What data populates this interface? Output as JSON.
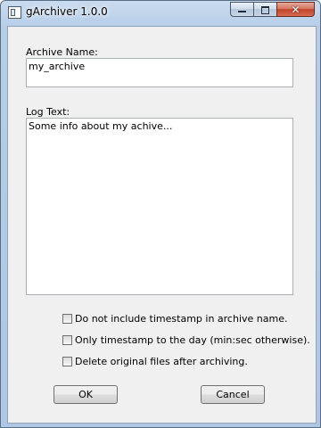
{
  "window": {
    "title": "gArchiver 1.0.0",
    "close_glyph": "✕"
  },
  "form": {
    "archive_name_label": "Archive Name:",
    "archive_name_value": "my_archive",
    "log_text_label": "Log Text:",
    "log_text_value": "Some info about my achive..."
  },
  "options": [
    {
      "label": "Do not include timestamp in archive name.",
      "checked": false
    },
    {
      "label": "Only timestamp to the day (min:sec otherwise).",
      "checked": false
    },
    {
      "label": "Delete original files after archiving.",
      "checked": false
    }
  ],
  "buttons": {
    "ok_label": "OK",
    "cancel_label": "Cancel"
  }
}
